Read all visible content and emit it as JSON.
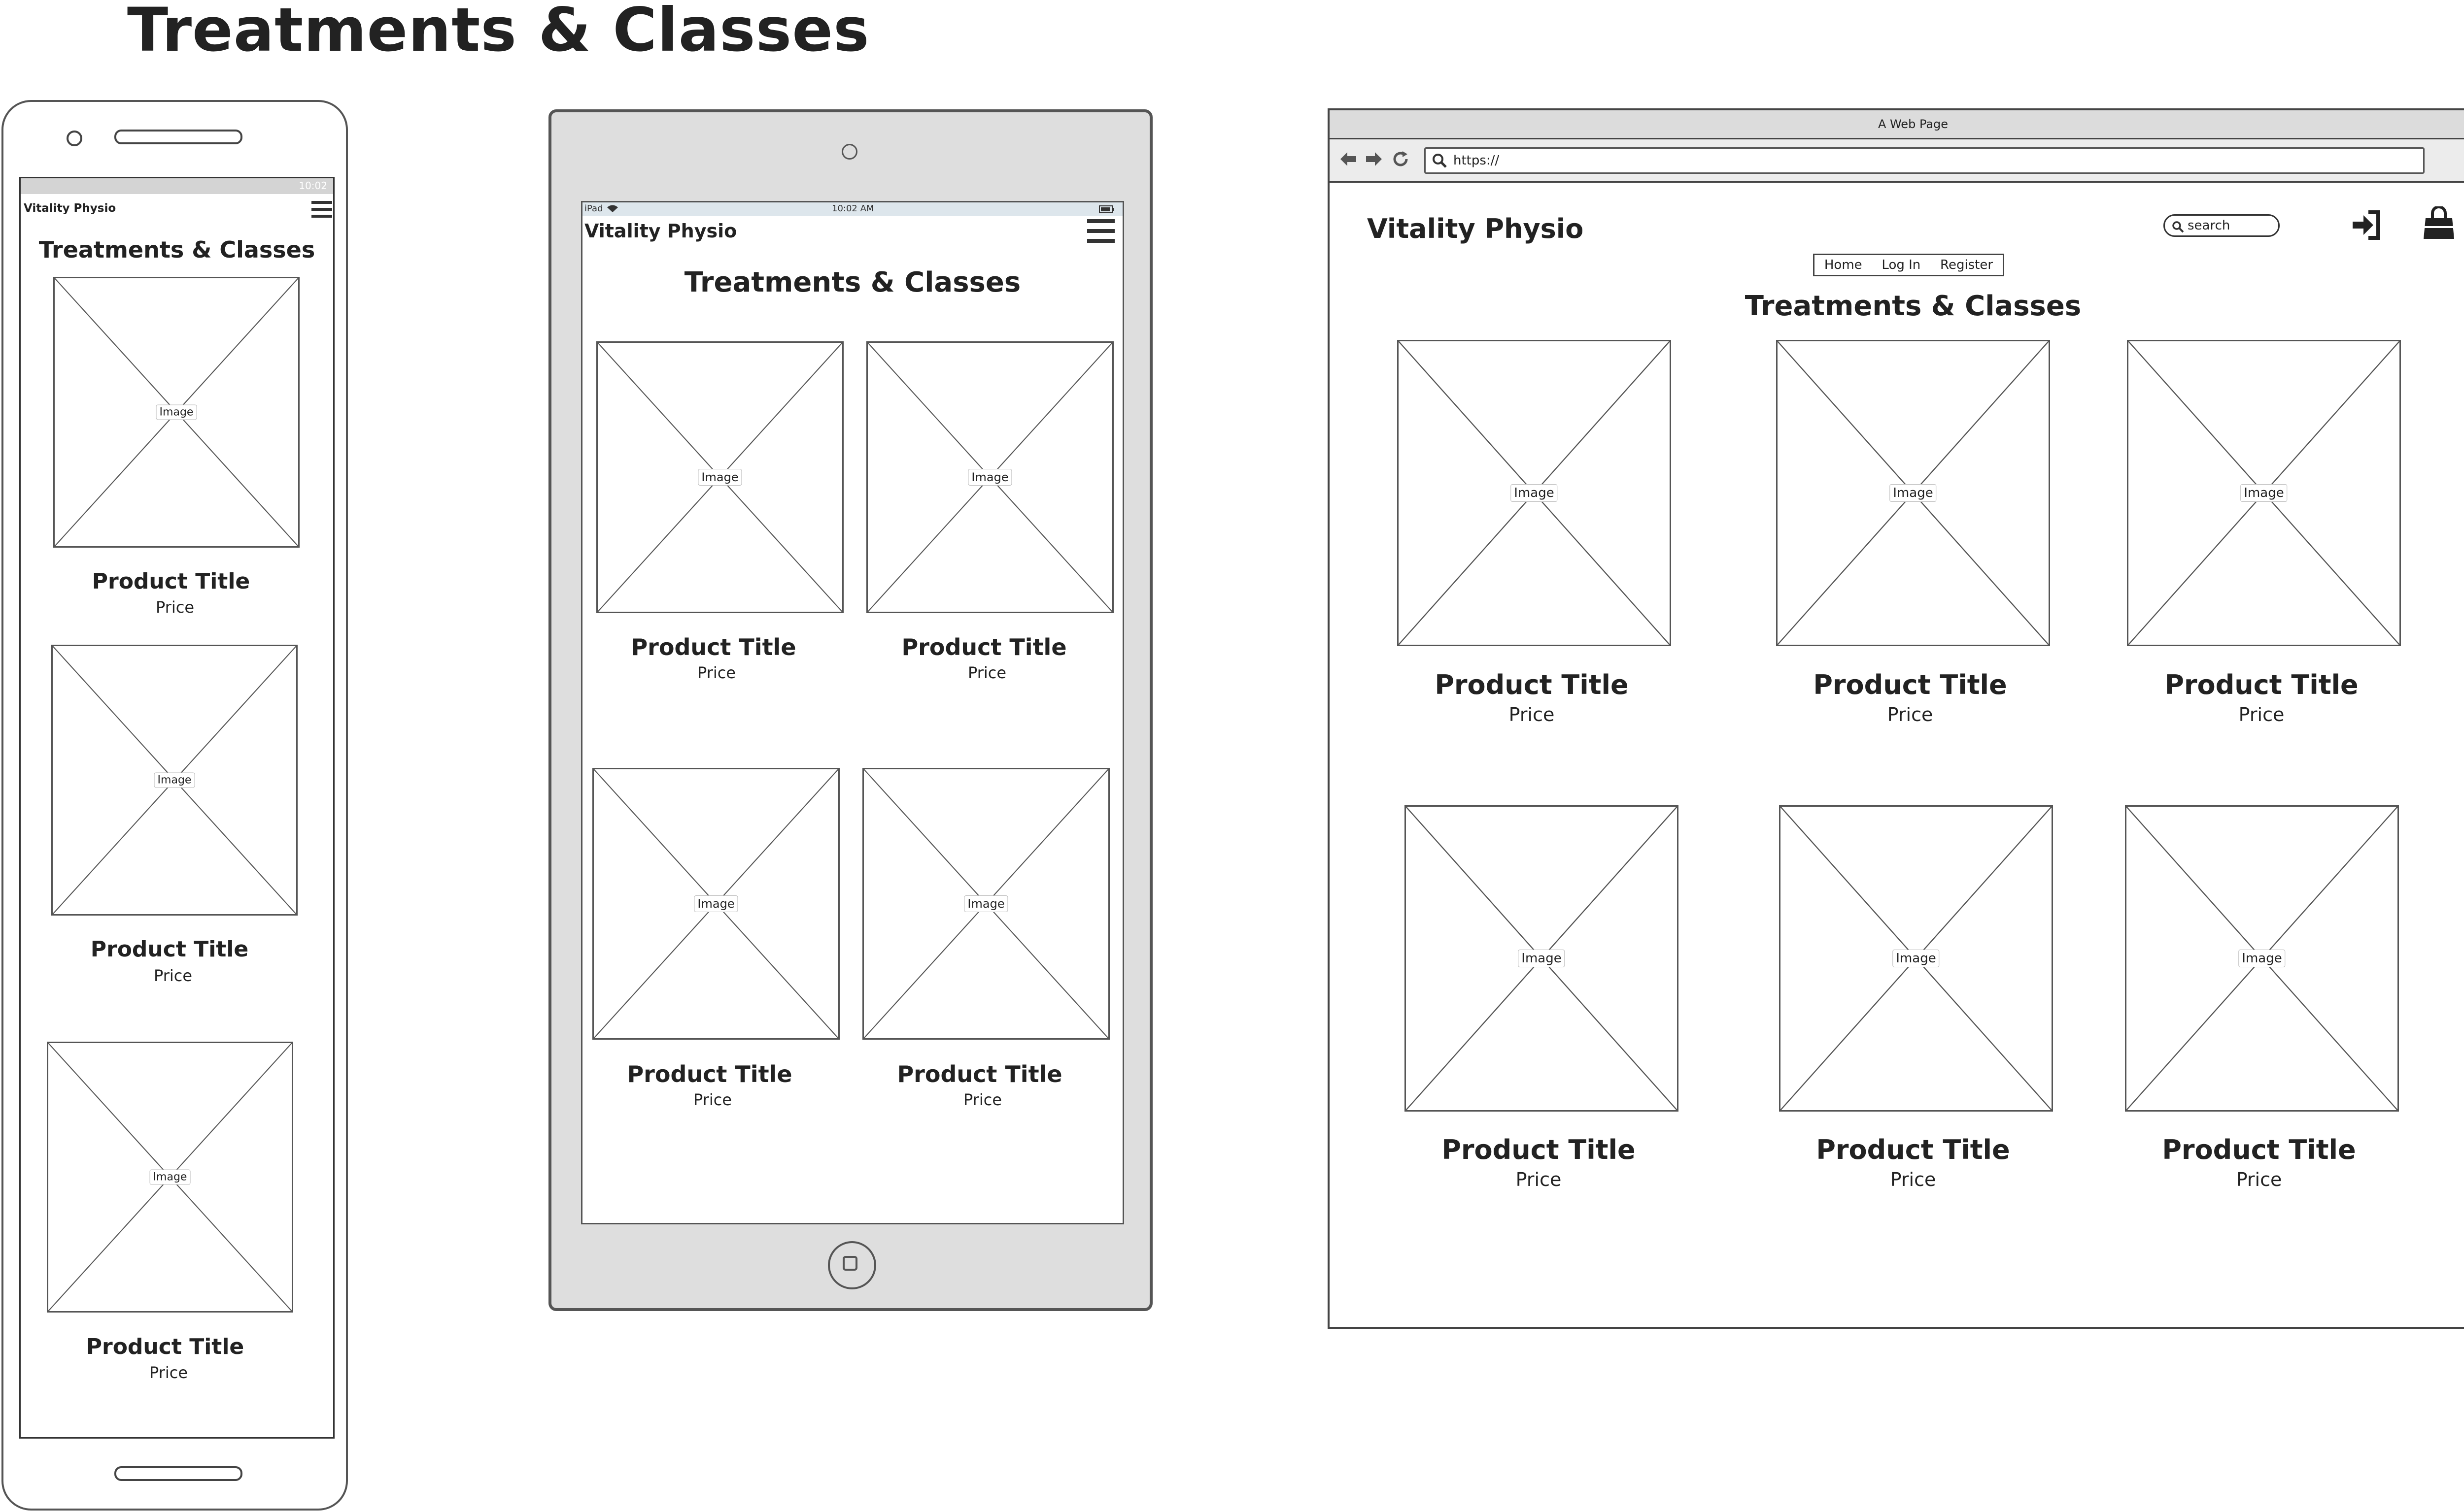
{
  "page_title": "Treatments & Classes",
  "phone": {
    "status_time": "10:02",
    "brand": "Vitality Physio",
    "heading": "Treatments & Classes",
    "menu_icon": "hamburger-icon",
    "products": [
      {
        "image_label": "Image",
        "title": "Product Title",
        "price": "Price"
      },
      {
        "image_label": "Image",
        "title": "Product Title",
        "price": "Price"
      },
      {
        "image_label": "Image",
        "title": "Product Title",
        "price": "Price"
      }
    ]
  },
  "tablet": {
    "status_left": "iPad",
    "status_time": "10:02 AM",
    "brand": "Vitality Physio",
    "heading": "Treatments & Classes",
    "menu_icon": "hamburger-icon",
    "products": [
      {
        "image_label": "Image",
        "title": "Product Title",
        "price": "Price"
      },
      {
        "image_label": "Image",
        "title": "Product Title",
        "price": "Price"
      },
      {
        "image_label": "Image",
        "title": "Product Title",
        "price": "Price"
      },
      {
        "image_label": "Image",
        "title": "Product Title",
        "price": "Price"
      }
    ]
  },
  "browser": {
    "window_title": "A Web Page",
    "url": "https://",
    "brand": "Vitality Physio",
    "search_placeholder": "search",
    "nav": [
      "Home",
      "Log In",
      "Register"
    ],
    "heading": "Treatments & Classes",
    "icons": [
      "back-arrow-icon",
      "forward-arrow-icon",
      "reload-icon",
      "search-icon",
      "menu-icon",
      "login-icon",
      "shopping-bag-icon"
    ],
    "products": [
      {
        "image_label": "Image",
        "title": "Product Title",
        "price": "Price"
      },
      {
        "image_label": "Image",
        "title": "Product Title",
        "price": "Price"
      },
      {
        "image_label": "Image",
        "title": "Product Title",
        "price": "Price"
      },
      {
        "image_label": "Image",
        "title": "Product Title",
        "price": "Price"
      },
      {
        "image_label": "Image",
        "title": "Product Title",
        "price": "Price"
      },
      {
        "image_label": "Image",
        "title": "Product Title",
        "price": "Price"
      }
    ]
  }
}
